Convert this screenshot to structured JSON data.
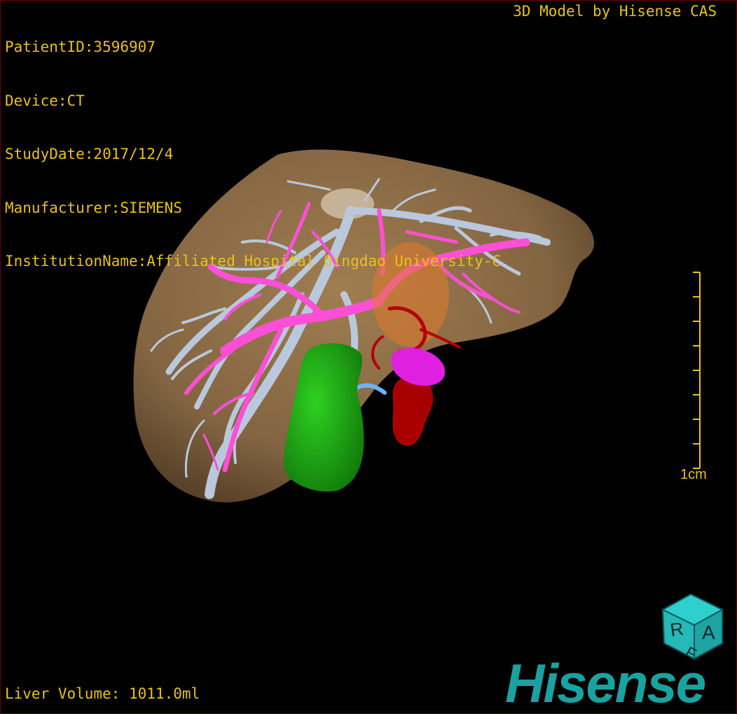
{
  "info": {
    "patient_id": "PatientID:3596907",
    "device": "Device:CT",
    "study_date": "StudyDate:2017/12/4",
    "manufacturer": "Manufacturer:SIEMENS",
    "institution": "InstitutionName:Affiliated Hospital Qingdao University-C"
  },
  "brand_top": "3D Model by Hisense CAS",
  "liver_volume": "Liver Volume: 1011.0ml",
  "scale": {
    "label": "1cm"
  },
  "orientation_cube": {
    "faces": [
      "R",
      "A",
      "F"
    ]
  },
  "logo": "Hisense",
  "colors": {
    "overlay_text": "#e8c21a",
    "liver": "#8a6a45",
    "hepatic_vein": "#b9c8dc",
    "portal_vein": "#ff4fd6",
    "tumor": "#1c9e12",
    "artery": "#b30000",
    "brand": "#19a3a0"
  }
}
